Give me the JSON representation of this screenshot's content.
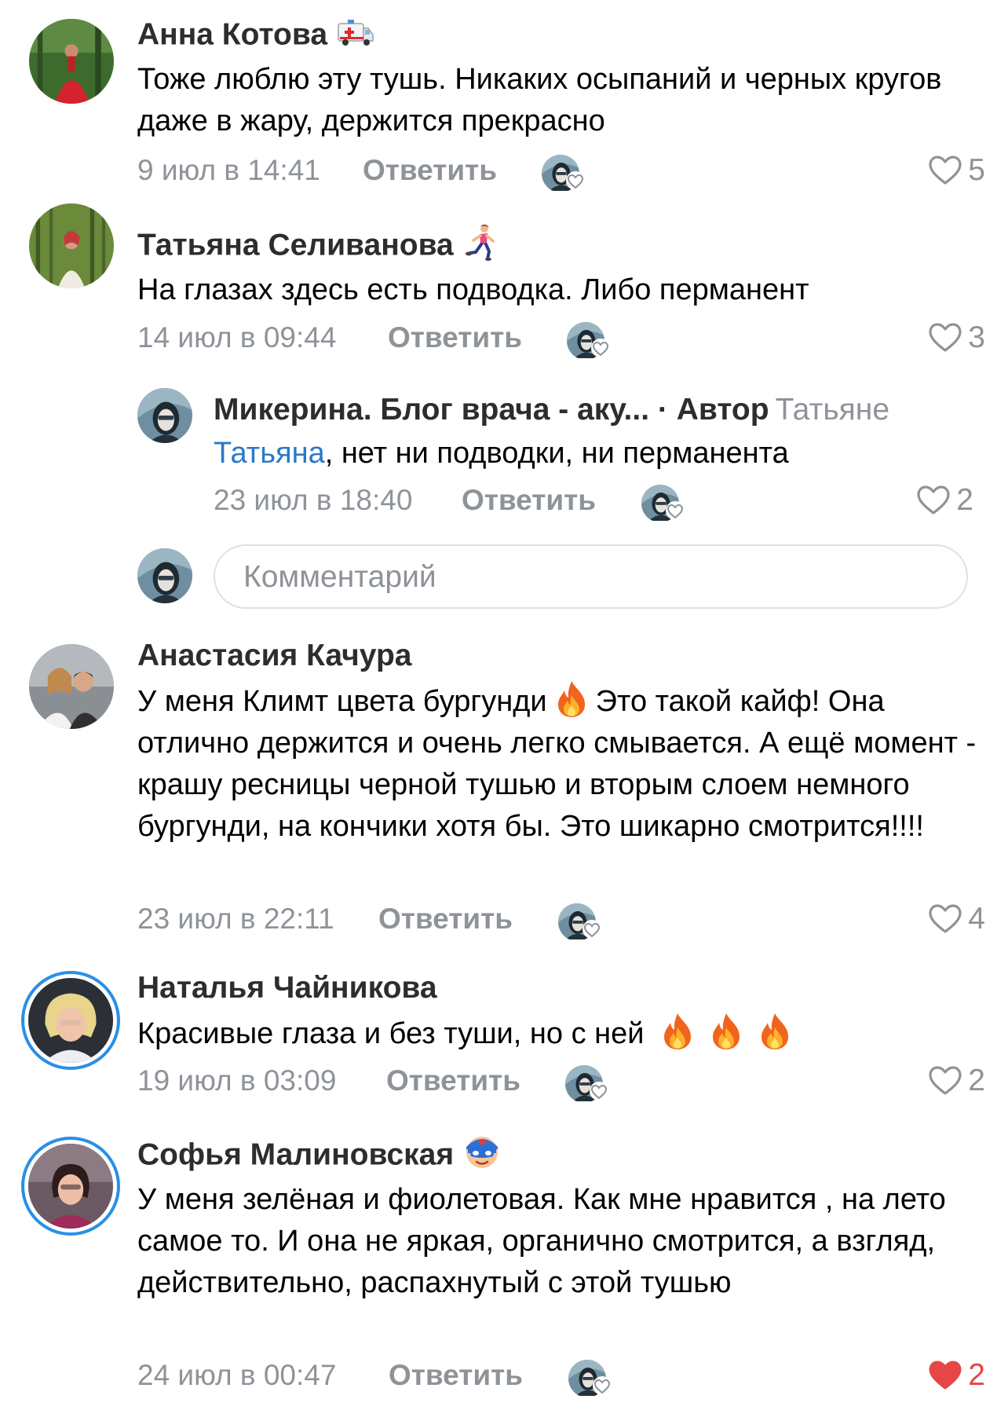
{
  "colors": {
    "accent": "#2a78c8",
    "muted": "#8e9399",
    "liked": "#e64646",
    "ring": "#2a8fe6"
  },
  "common": {
    "reply_label": "Ответить"
  },
  "comments": [
    {
      "author": "Анна Котова",
      "author_emoji": "ambulance-emoji",
      "text": "Тоже люблю эту тушь. Никаких осыпаний и черных кругов даже в жару, держится прекрасно",
      "date": "9 июл в 14:41",
      "likes": "5",
      "liked": false
    },
    {
      "author": "Татьяна Селиванова",
      "author_emoji": "runner-emoji",
      "text": "На глазах здесь есть подводка. Либо перманент",
      "date": "14 июл в 09:44",
      "likes": "3",
      "liked": false,
      "reply": {
        "author": "Микерина. Блог врача - аку... · Автор",
        "to": "Татьяне",
        "mention": "Татьяна",
        "text": ", нет ни подводки, ни перманента",
        "date": "23 июл в 18:40",
        "likes": "2",
        "liked": false
      },
      "input_placeholder": "Комментарий"
    },
    {
      "author": "Анастасия Качура",
      "text_part1": "У меня Климт цвета бургунди",
      "text_part2": "Это такой кайф! Она отлично держится и очень легко смывается. А ещё момент - крашу ресницы черной тушью и вторым слоем немного бургунди, на кончики хотя бы. Это шикарно смотрится!!!!",
      "date": "23 июл в 22:11",
      "likes": "4",
      "liked": false
    },
    {
      "author": "Наталья Чайникова",
      "text": "Красивые глаза и без туши, но с ней",
      "text_emoji": "fire-emoji x3",
      "date": "19 июл в 03:09",
      "likes": "2",
      "liked": false
    },
    {
      "author": "Софья Малиновская",
      "author_emoji": "superhero-emoji",
      "text": "У меня зелёная и фиолетовая. Как мне нравится , на лето самое то.  И она не яркая, органично смотрится, а взгляд, действительно, распахнутый с этой тушью",
      "date": "24 июл в 00:47",
      "likes": "2",
      "liked": true
    }
  ]
}
